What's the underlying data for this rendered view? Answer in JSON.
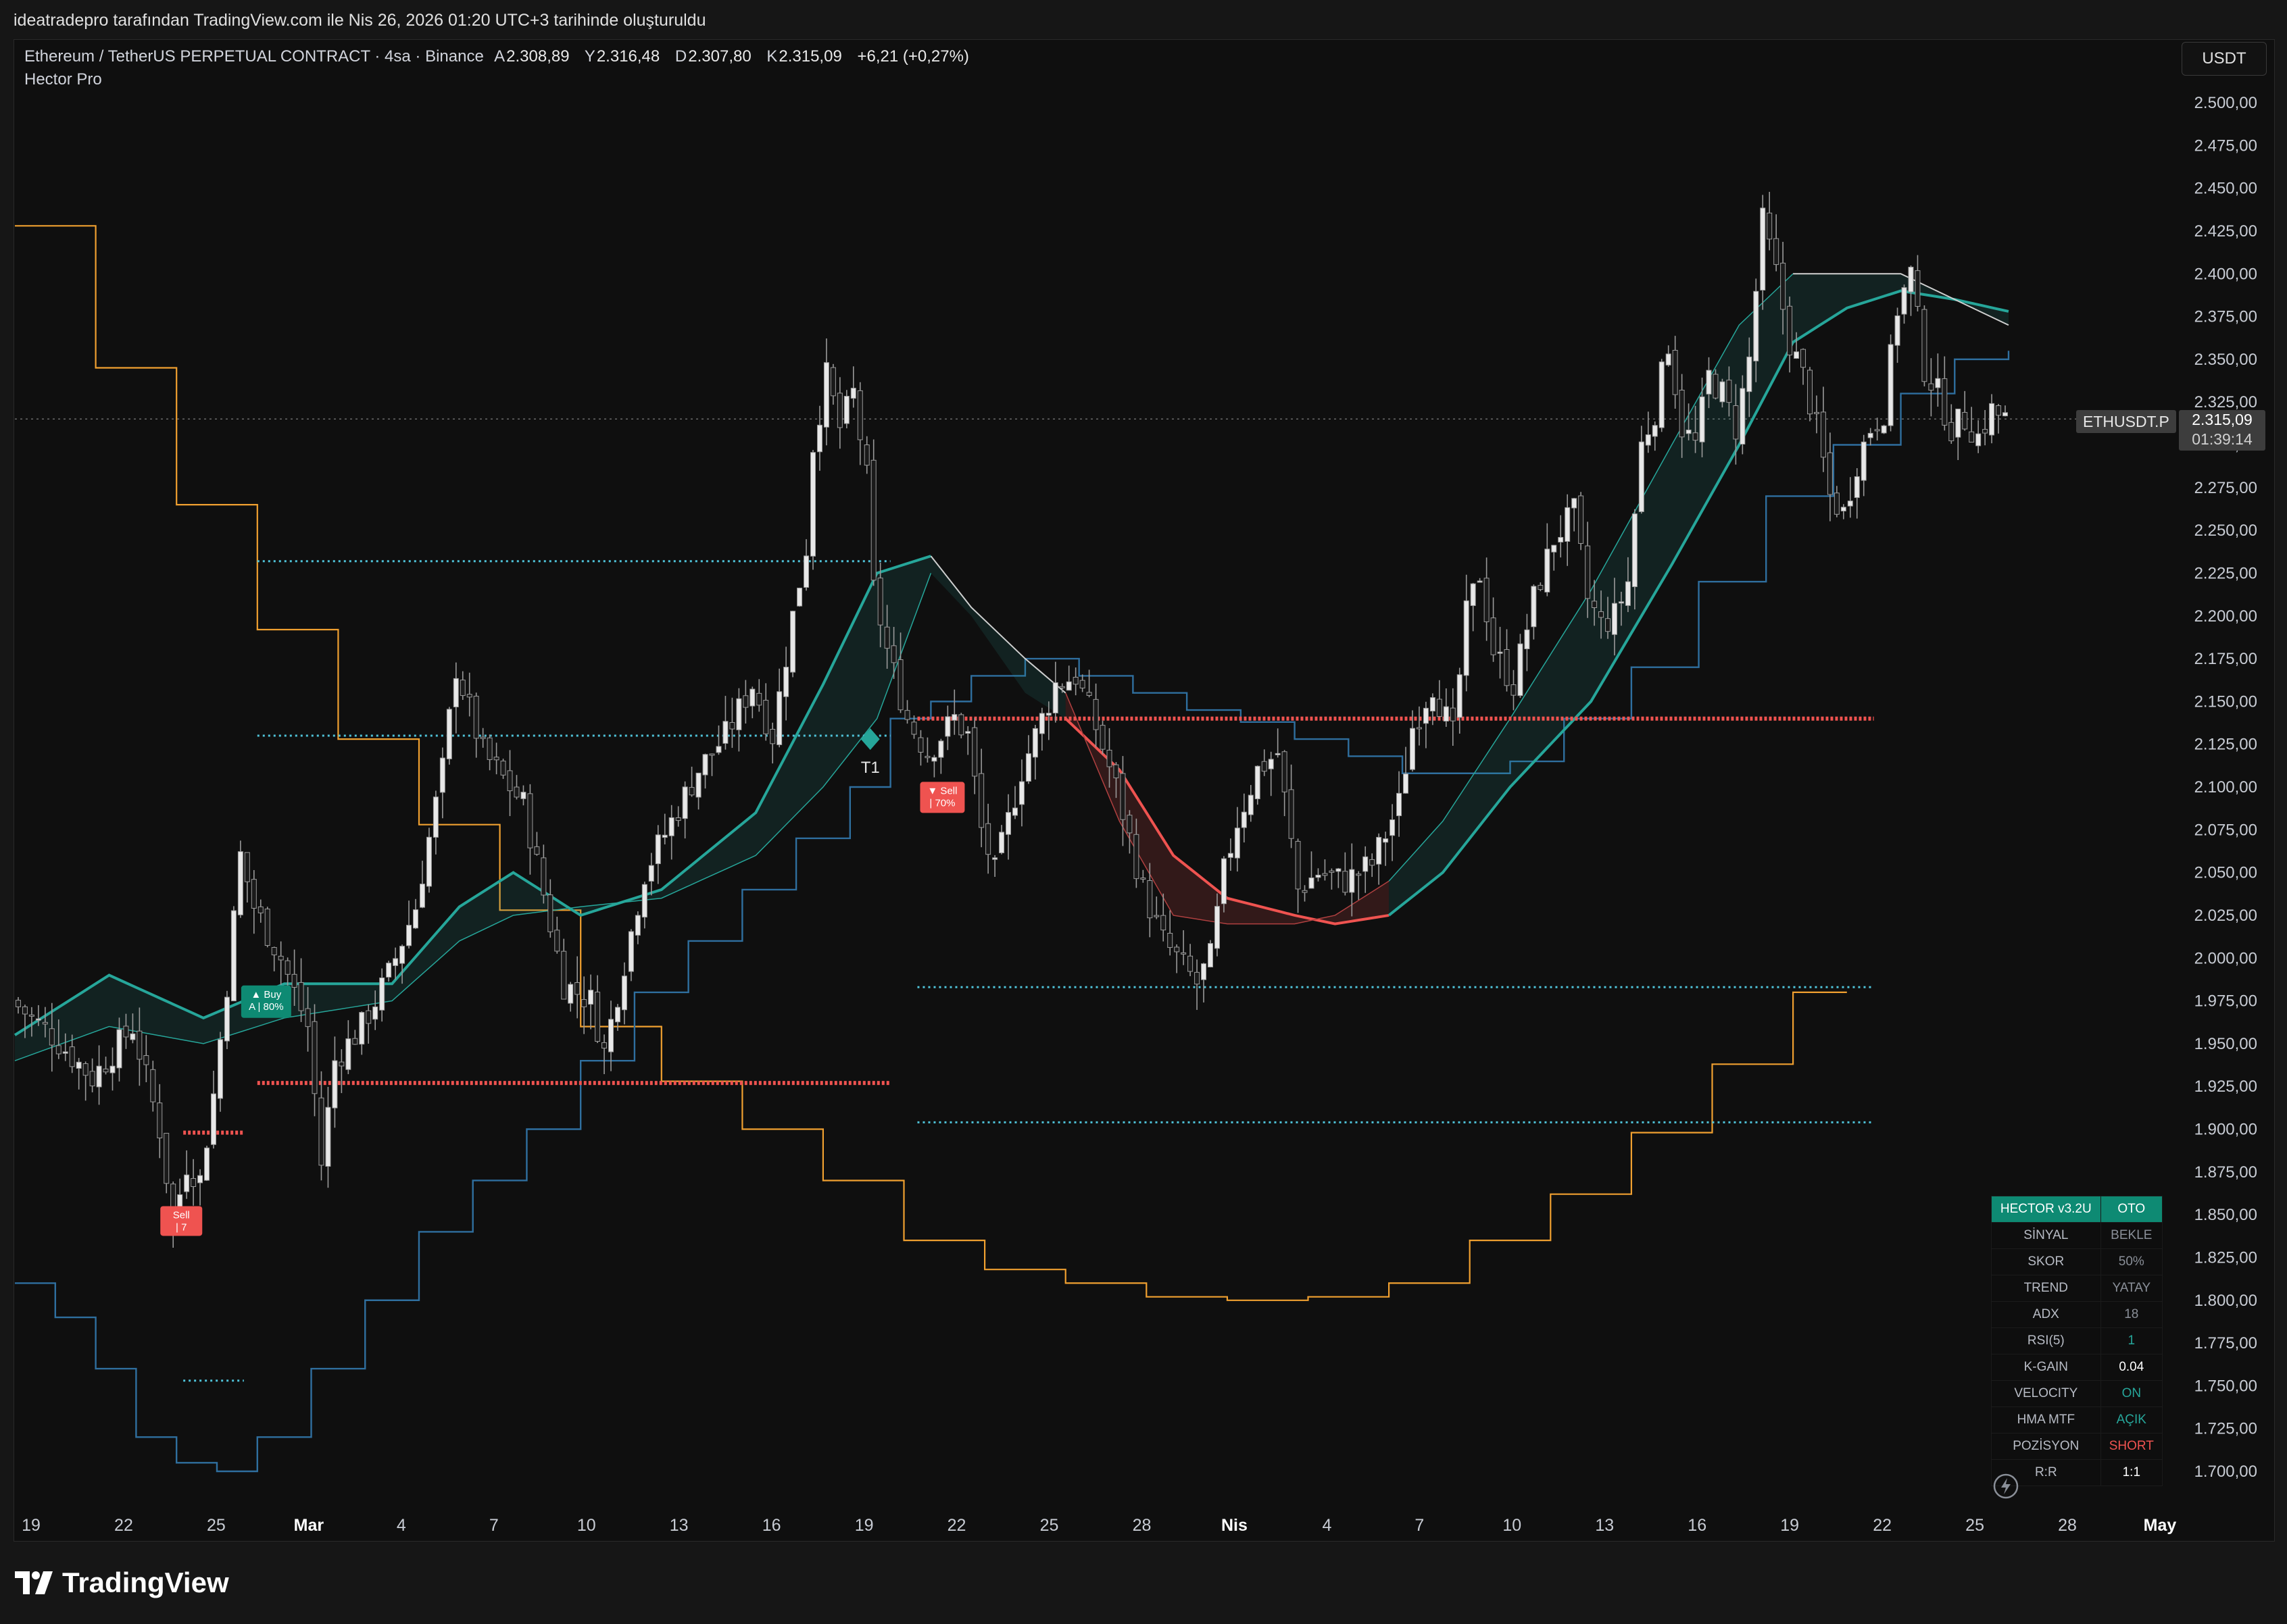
{
  "header": {
    "caption": "ideatradepro tarafından TradingView.com ile Nis 26, 2026 01:20 UTC+3 tarihinde oluşturuldu"
  },
  "legend": {
    "symbol": "Ethereum / TetherUS PERPETUAL CONTRACT · 4sa · Binance",
    "open_label": "A",
    "open": "2.308,89",
    "high_label": "Y",
    "high": "2.316,48",
    "low_label": "D",
    "low": "2.307,80",
    "close_label": "K",
    "close": "2.315,09",
    "change": "+6,21 (+0,27%)",
    "indicator": "Hector Pro"
  },
  "toolbar": {
    "currency": "USDT"
  },
  "price_marker": {
    "symbol": "ETHUSDT.P",
    "price": "2.315,09",
    "countdown": "01:39:14"
  },
  "signals": {
    "buy_label": "▲ Buy",
    "buy_sub": "A | 80%",
    "sell_label_1": "Sell",
    "sell_sub_1": "| 7",
    "sell_label_2": "▼ Sell",
    "sell_sub_2": "| 70%",
    "target": "T1"
  },
  "table": {
    "title": "HECTOR v3.2U",
    "mode": "OTO",
    "rows": [
      {
        "key": "SİNYAL",
        "value": "BEKLE",
        "color": "#8a8f98"
      },
      {
        "key": "SKOR",
        "value": "50%",
        "color": "#8a8f98"
      },
      {
        "key": "TREND",
        "value": "YATAY",
        "color": "#8a8f98"
      },
      {
        "key": "ADX",
        "value": "18",
        "color": "#8a8f98"
      },
      {
        "key": "RSI(5)",
        "value": "1",
        "color": "#26a69a"
      },
      {
        "key": "K-GAIN",
        "value": "0.04",
        "color": "#ffffff"
      },
      {
        "key": "VELOCITY",
        "value": "ON",
        "color": "#26a69a"
      },
      {
        "key": "HMA MTF",
        "value": "AÇIK",
        "color": "#26a69a"
      },
      {
        "key": "POZİSYON",
        "value": "SHORT",
        "color": "#ef5350"
      },
      {
        "key": "R:R",
        "value": "1:1",
        "color": "#ffffff"
      }
    ]
  },
  "footer": {
    "brand": "TradingView"
  },
  "colors": {
    "teal": "#26a69a",
    "red": "#ef5350",
    "orange": "#f0a030",
    "blue": "#2f6f9f",
    "cyan_dots": "#4fc3d9"
  },
  "chart_data": {
    "type": "candlestick",
    "symbol": "ETHUSDT.P",
    "timeframe": "4sa",
    "ylim": [
      1690,
      2510
    ],
    "y_ticks": [
      "2.500,00",
      "2.475,00",
      "2.450,00",
      "2.425,00",
      "2.400,00",
      "2.375,00",
      "2.350,00",
      "2.325,00",
      "2.300,00",
      "2.275,00",
      "2.250,00",
      "2.225,00",
      "2.200,00",
      "2.175,00",
      "2.150,00",
      "2.125,00",
      "2.100,00",
      "2.075,00",
      "2.050,00",
      "2.025,00",
      "2.000,00",
      "1.975,00",
      "1.950,00",
      "1.925,00",
      "1.900,00",
      "1.875,00",
      "1.850,00",
      "1.825,00",
      "1.800,00",
      "1.775,00",
      "1.750,00",
      "1.725,00",
      "1.700,00"
    ],
    "x_ticks": [
      "19",
      "22",
      "25",
      "Mar",
      "4",
      "7",
      "10",
      "13",
      "16",
      "19",
      "22",
      "25",
      "28",
      "Nis",
      "4",
      "7",
      "10",
      "13",
      "16",
      "19",
      "22",
      "25",
      "28",
      "May"
    ],
    "last_price": 2315.09,
    "close_path": [
      [
        0,
        1975
      ],
      [
        6,
        1955
      ],
      [
        12,
        1930
      ],
      [
        18,
        1960
      ],
      [
        22,
        1900
      ],
      [
        24,
        1845
      ],
      [
        26,
        1880
      ],
      [
        28,
        1870
      ],
      [
        30,
        1920
      ],
      [
        32,
        1985
      ],
      [
        34,
        2060
      ],
      [
        36,
        2030
      ],
      [
        40,
        2000
      ],
      [
        44,
        1960
      ],
      [
        46,
        1880
      ],
      [
        48,
        1940
      ],
      [
        52,
        1960
      ],
      [
        56,
        1990
      ],
      [
        60,
        2030
      ],
      [
        64,
        2110
      ],
      [
        66,
        2170
      ],
      [
        70,
        2120
      ],
      [
        76,
        2090
      ],
      [
        82,
        1985
      ],
      [
        86,
        1975
      ],
      [
        88,
        1945
      ],
      [
        94,
        2050
      ],
      [
        98,
        2080
      ],
      [
        102,
        2110
      ],
      [
        106,
        2130
      ],
      [
        110,
        2160
      ],
      [
        113,
        2130
      ],
      [
        116,
        2200
      ],
      [
        118,
        2240
      ],
      [
        119,
        2300
      ],
      [
        121,
        2340
      ],
      [
        123,
        2310
      ],
      [
        125,
        2330
      ],
      [
        127,
        2280
      ],
      [
        128,
        2215
      ],
      [
        130,
        2180
      ],
      [
        133,
        2140
      ],
      [
        136,
        2120
      ],
      [
        140,
        2140
      ],
      [
        142,
        2130
      ],
      [
        144,
        2075
      ],
      [
        146,
        2050
      ],
      [
        150,
        2110
      ],
      [
        155,
        2160
      ],
      [
        158,
        2165
      ],
      [
        161,
        2135
      ],
      [
        164,
        2100
      ],
      [
        166,
        2070
      ],
      [
        168,
        2040
      ],
      [
        171,
        2010
      ],
      [
        174,
        1995
      ],
      [
        176,
        1985
      ],
      [
        178,
        2000
      ],
      [
        180,
        2050
      ],
      [
        182,
        2080
      ],
      [
        185,
        2110
      ],
      [
        188,
        2120
      ],
      [
        191,
        2040
      ],
      [
        194,
        2050
      ],
      [
        198,
        2045
      ],
      [
        202,
        2055
      ],
      [
        206,
        2090
      ],
      [
        208,
        2135
      ],
      [
        211,
        2160
      ],
      [
        214,
        2130
      ],
      [
        216,
        2200
      ],
      [
        218,
        2225
      ],
      [
        220,
        2180
      ],
      [
        223,
        2160
      ],
      [
        226,
        2210
      ],
      [
        229,
        2245
      ],
      [
        232,
        2260
      ],
      [
        234,
        2210
      ],
      [
        236,
        2195
      ],
      [
        238,
        2200
      ],
      [
        240,
        2220
      ],
      [
        242,
        2300
      ],
      [
        244,
        2320
      ],
      [
        246,
        2360
      ],
      [
        248,
        2310
      ],
      [
        250,
        2300
      ],
      [
        252,
        2340
      ],
      [
        254,
        2330
      ],
      [
        256,
        2310
      ],
      [
        258,
        2350
      ],
      [
        260,
        2430
      ],
      [
        262,
        2400
      ],
      [
        264,
        2360
      ],
      [
        266,
        2340
      ],
      [
        268,
        2310
      ],
      [
        270,
        2270
      ],
      [
        272,
        2260
      ],
      [
        274,
        2290
      ],
      [
        276,
        2310
      ],
      [
        278,
        2320
      ],
      [
        280,
        2380
      ],
      [
        282,
        2400
      ],
      [
        284,
        2345
      ],
      [
        286,
        2330
      ],
      [
        288,
        2310
      ],
      [
        290,
        2315
      ],
      [
        292,
        2305
      ],
      [
        294,
        2320
      ],
      [
        296,
        2315
      ]
    ],
    "hma_band": {
      "colors": [
        "#26a69a",
        "#ef5350"
      ],
      "upper": [
        [
          0,
          1955
        ],
        [
          14,
          1990
        ],
        [
          28,
          1965
        ],
        [
          40,
          1985
        ],
        [
          56,
          1985
        ],
        [
          66,
          2030
        ],
        [
          74,
          2050
        ],
        [
          84,
          2025
        ],
        [
          96,
          2040
        ],
        [
          110,
          2085
        ],
        [
          120,
          2160
        ],
        [
          128,
          2225
        ],
        [
          136,
          2235
        ],
        [
          142,
          2205
        ],
        [
          150,
          2175
        ],
        [
          156,
          2155
        ],
        [
          164,
          2080
        ],
        [
          172,
          2025
        ],
        [
          180,
          2020
        ],
        [
          190,
          2020
        ],
        [
          196,
          2025
        ],
        [
          204,
          2045
        ],
        [
          212,
          2080
        ],
        [
          222,
          2140
        ],
        [
          234,
          2215
        ],
        [
          246,
          2300
        ],
        [
          256,
          2370
        ],
        [
          264,
          2400
        ],
        [
          272,
          2400
        ],
        [
          280,
          2400
        ],
        [
          288,
          2385
        ],
        [
          296,
          2370
        ]
      ],
      "lower": [
        [
          0,
          1940
        ],
        [
          14,
          1960
        ],
        [
          28,
          1950
        ],
        [
          40,
          1965
        ],
        [
          56,
          1975
        ],
        [
          66,
          2010
        ],
        [
          74,
          2025
        ],
        [
          84,
          2030
        ],
        [
          96,
          2035
        ],
        [
          110,
          2060
        ],
        [
          120,
          2100
        ],
        [
          128,
          2140
        ],
        [
          136,
          2225
        ],
        [
          142,
          2200
        ],
        [
          150,
          2155
        ],
        [
          156,
          2140
        ],
        [
          164,
          2110
        ],
        [
          172,
          2060
        ],
        [
          180,
          2035
        ],
        [
          190,
          2025
        ],
        [
          196,
          2020
        ],
        [
          204,
          2025
        ],
        [
          212,
          2050
        ],
        [
          222,
          2100
        ],
        [
          234,
          2150
        ],
        [
          246,
          2230
        ],
        [
          256,
          2300
        ],
        [
          264,
          2360
        ],
        [
          272,
          2380
        ],
        [
          280,
          2390
        ],
        [
          288,
          2385
        ],
        [
          296,
          2378
        ]
      ]
    },
    "orange_step": [
      [
        0,
        2428
      ],
      [
        12,
        2428
      ],
      [
        12,
        2345
      ],
      [
        24,
        2345
      ],
      [
        24,
        2265
      ],
      [
        36,
        2265
      ],
      [
        36,
        2192
      ],
      [
        48,
        2192
      ],
      [
        48,
        2128
      ],
      [
        60,
        2128
      ],
      [
        60,
        2078
      ],
      [
        72,
        2078
      ],
      [
        72,
        2028
      ],
      [
        84,
        2028
      ],
      [
        84,
        1960
      ],
      [
        96,
        1960
      ],
      [
        96,
        1928
      ],
      [
        108,
        1928
      ],
      [
        108,
        1900
      ],
      [
        120,
        1900
      ],
      [
        120,
        1870
      ],
      [
        132,
        1870
      ],
      [
        132,
        1835
      ],
      [
        144,
        1835
      ],
      [
        144,
        1818
      ],
      [
        156,
        1818
      ],
      [
        156,
        1810
      ],
      [
        168,
        1810
      ],
      [
        168,
        1802
      ],
      [
        180,
        1802
      ],
      [
        180,
        1800
      ],
      [
        192,
        1800
      ],
      [
        192,
        1802
      ],
      [
        204,
        1802
      ],
      [
        204,
        1810
      ],
      [
        216,
        1810
      ],
      [
        216,
        1835
      ],
      [
        228,
        1835
      ],
      [
        228,
        1862
      ],
      [
        240,
        1862
      ],
      [
        240,
        1898
      ],
      [
        252,
        1898
      ],
      [
        252,
        1938
      ],
      [
        264,
        1938
      ],
      [
        264,
        1980
      ],
      [
        272,
        1980
      ]
    ],
    "blue_trail": [
      [
        0,
        1810
      ],
      [
        6,
        1790
      ],
      [
        12,
        1760
      ],
      [
        18,
        1720
      ],
      [
        24,
        1705
      ],
      [
        30,
        1700
      ],
      [
        36,
        1720
      ],
      [
        44,
        1760
      ],
      [
        52,
        1800
      ],
      [
        60,
        1840
      ],
      [
        68,
        1870
      ],
      [
        76,
        1900
      ],
      [
        84,
        1940
      ],
      [
        92,
        1980
      ],
      [
        100,
        2010
      ],
      [
        108,
        2040
      ],
      [
        116,
        2070
      ],
      [
        124,
        2100
      ],
      [
        130,
        2140
      ],
      [
        136,
        2150
      ],
      [
        142,
        2165
      ],
      [
        150,
        2175
      ],
      [
        158,
        2165
      ],
      [
        166,
        2155
      ],
      [
        174,
        2145
      ],
      [
        182,
        2138
      ],
      [
        190,
        2128
      ],
      [
        198,
        2118
      ],
      [
        206,
        2108
      ],
      [
        214,
        2108
      ],
      [
        222,
        2115
      ],
      [
        230,
        2140
      ],
      [
        240,
        2170
      ],
      [
        250,
        2220
      ],
      [
        260,
        2270
      ],
      [
        270,
        2300
      ],
      [
        280,
        2330
      ],
      [
        288,
        2350
      ],
      [
        296,
        2355
      ]
    ],
    "horizontal_levels": [
      {
        "price": 2232,
        "x0": 36,
        "x1": 130,
        "color": "#4fc3d9",
        "style": "dots"
      },
      {
        "price": 2130,
        "x0": 36,
        "x1": 130,
        "color": "#4fc3d9",
        "style": "dots"
      },
      {
        "price": 1927,
        "x0": 36,
        "x1": 130,
        "color": "#ef5350",
        "style": "thick-dots"
      },
      {
        "price": 1898,
        "x0": 25,
        "x1": 34,
        "color": "#ef5350",
        "style": "thick-dots"
      },
      {
        "price": 1753,
        "x0": 25,
        "x1": 34,
        "color": "#4fc3d9",
        "style": "dots"
      },
      {
        "price": 2140,
        "x0": 134,
        "x1": 276,
        "color": "#ef5350",
        "style": "thick-dots"
      },
      {
        "price": 1983,
        "x0": 134,
        "x1": 276,
        "color": "#4fc3d9",
        "style": "dots"
      },
      {
        "price": 1904,
        "x0": 134,
        "x1": 276,
        "color": "#4fc3d9",
        "style": "dots"
      }
    ],
    "markers": [
      {
        "type": "buy",
        "index": 34,
        "price": 1960
      },
      {
        "type": "sell",
        "index": 26,
        "price": 1840
      },
      {
        "type": "sell",
        "index": 135,
        "price": 2090
      },
      {
        "type": "target",
        "index": 127,
        "price": 2128
      }
    ]
  }
}
